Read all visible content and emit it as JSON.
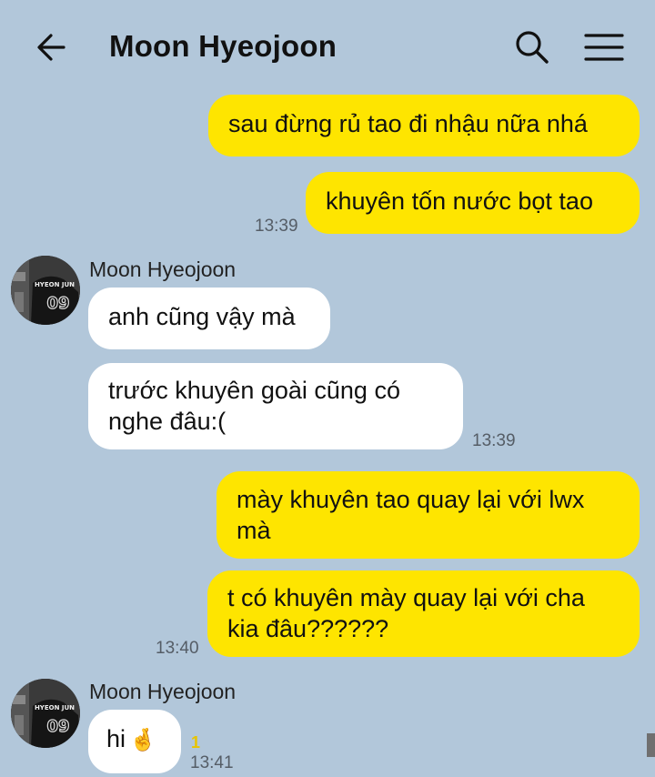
{
  "header": {
    "title": "Moon Hyeojoon",
    "back_icon": "arrow-left-icon",
    "search_icon": "search-icon",
    "menu_icon": "hamburger-menu-icon"
  },
  "messages": {
    "m1": "sau đừng rủ tao đi nhậu nữa nhá",
    "m2": "khuyên tốn nước bọt tao",
    "t1": "13:39",
    "sender1": "Moon Hyeojoon",
    "m3": "anh cũng vậy mà",
    "m4_line1": "trước khuyên goài cũng có",
    "m4_line2": "nghe đâu:(",
    "t2": "13:39",
    "m5_line1": "mày khuyên tao quay lại với lwx",
    "m5_line2": "mà",
    "m6_line1": "t có khuyên mày quay lại với cha",
    "m6_line2": "kia đâu??????",
    "t3": "13:40",
    "sender2": "Moon Hyeojoon",
    "m7": "hi",
    "m7_emoji": "🤞",
    "unread_count": "1",
    "t4": "13:41"
  },
  "avatar": {
    "jersey_text": "HYEON JUN",
    "jersey_number": "09"
  },
  "colors": {
    "background": "#b2c7da",
    "my_bubble": "#fee500",
    "their_bubble": "#ffffff",
    "unread": "#e8c400"
  }
}
